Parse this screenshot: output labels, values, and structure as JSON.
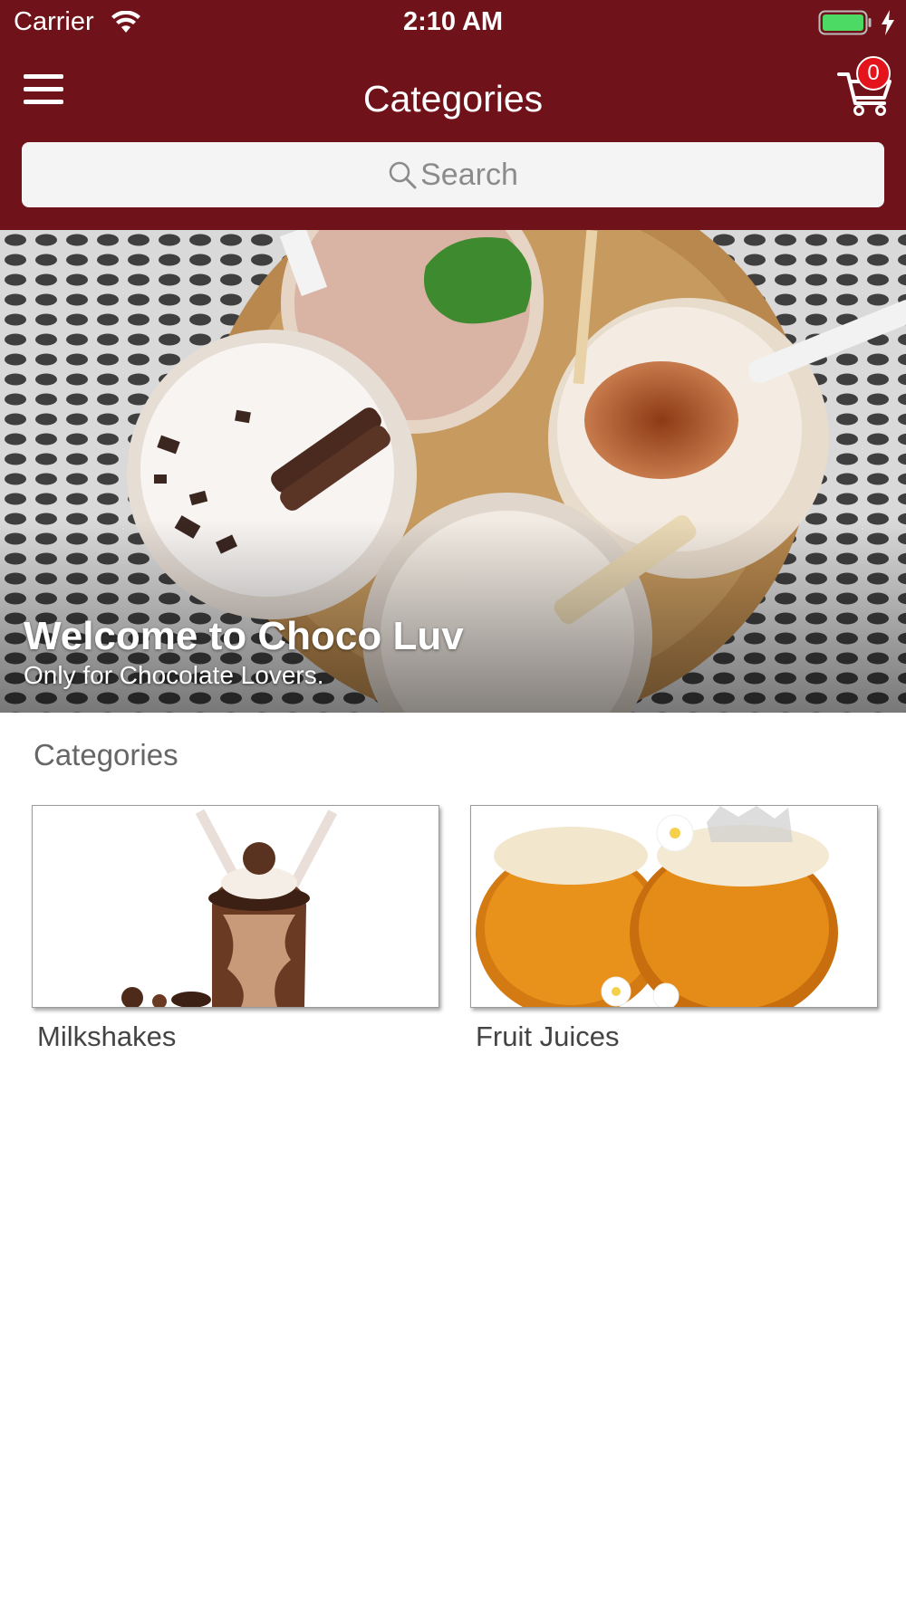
{
  "status_bar": {
    "carrier": "Carrier",
    "time": "2:10 AM"
  },
  "header": {
    "title": "Categories",
    "cart_count": "0",
    "search_placeholder": "Search",
    "background_color": "#701219"
  },
  "hero": {
    "title": "Welcome to Choco Luv",
    "subtitle": "Only for Chocolate Lovers."
  },
  "categories_section": {
    "title": "Categories",
    "items": [
      {
        "label": "Milkshakes"
      },
      {
        "label": "Fruit Juices"
      }
    ]
  },
  "colors": {
    "header": "#701219",
    "badge": "#e4141c",
    "battery": "#4cd964"
  }
}
